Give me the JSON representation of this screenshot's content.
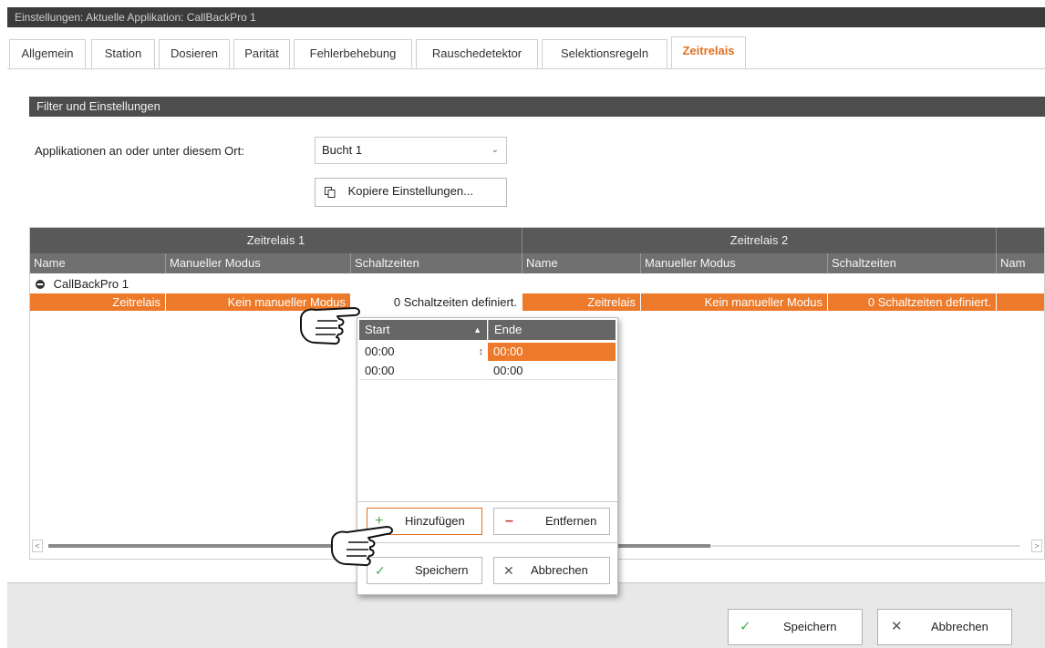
{
  "window": {
    "title": "Einstellungen: Aktuelle Applikation: CallBackPro 1"
  },
  "tabs": [
    {
      "label": "Allgemein"
    },
    {
      "label": "Station"
    },
    {
      "label": "Dosieren"
    },
    {
      "label": "Parität"
    },
    {
      "label": "Fehlerbehebung"
    },
    {
      "label": "Rauschedetektor"
    },
    {
      "label": "Selektionsregeln"
    },
    {
      "label": "Zeitrelais",
      "active": true
    }
  ],
  "panel": {
    "title": "Filter und Einstellungen",
    "location_label": "Applikationen an oder unter diesem Ort:",
    "location_value": "Bucht 1",
    "copy_button": "Kopiere Einstellungen..."
  },
  "grid": {
    "groups": [
      "Zeitrelais 1",
      "Zeitrelais 2"
    ],
    "columns": [
      "Name",
      "Manueller Modus",
      "Schaltzeiten",
      "Name",
      "Manueller Modus",
      "Schaltzeiten",
      "Nam"
    ],
    "group_row": "CallBackPro 1",
    "row": [
      "Zeitrelais",
      "Kein manueller Modus",
      "0 Schaltzeiten definiert.",
      "Zeitrelais",
      "Kein manueller Modus",
      "0 Schaltzeiten definiert."
    ]
  },
  "popup": {
    "col_start": "Start",
    "col_end": "Ende",
    "rows": [
      {
        "start": "00:00",
        "end": "00:00"
      },
      {
        "start": "00:00",
        "end": "00:00"
      }
    ],
    "add_button": "Hinzufügen",
    "remove_button": "Entfernen",
    "save_button": "Speichern",
    "cancel_button": "Abbrechen"
  },
  "footer": {
    "save_button": "Speichern",
    "cancel_button": "Abbrechen"
  },
  "colors": {
    "accent": "#ec7a2a",
    "header_dark": "#4d4d4d",
    "check_green": "#4caf50",
    "minus_red": "#c0392b"
  }
}
